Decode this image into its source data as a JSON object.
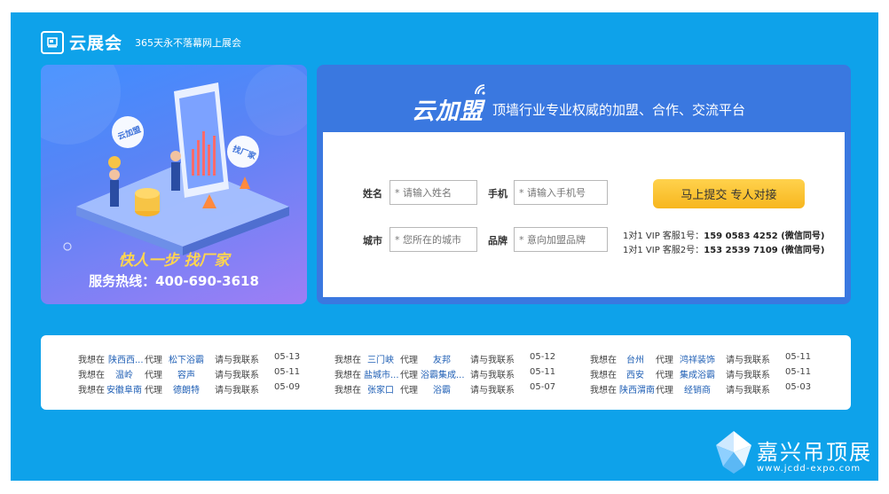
{
  "header": {
    "logo_name": "云展会",
    "slogan": "365天永不落幕网上展会"
  },
  "promo": {
    "title": "快人一步 找厂家",
    "hotline": "服务热线：400-690-3618",
    "bubble_left": "云加盟",
    "bubble_right": "找厂家"
  },
  "form": {
    "brand_name": "云加盟",
    "brand_slogan": "顶墙行业专业权威的加盟、合作、交流平台",
    "name_label": "姓名",
    "name_placeholder": "* 请输入姓名",
    "phone_label": "手机",
    "phone_placeholder": "* 请输入手机号",
    "city_label": "城市",
    "city_placeholder": "* 您所在的城市",
    "brand_label": "品牌",
    "brand_placeholder": "* 意向加盟品牌",
    "submit_label": "马上提交 专人对接",
    "service1_prefix": "1对1 VIP 客服1号：",
    "service1_number": "159 0583 4252 (微信同号)",
    "service2_prefix": "1对1 VIP 客服2号：",
    "service2_number": "153 2539 7109 (微信同号)"
  },
  "requests": [
    [
      {
        "want": "我想在",
        "city": "陕西西...",
        "act": "代理",
        "brand": "松下浴霸",
        "contact": "请与我联系",
        "date": "05-13"
      },
      {
        "want": "我想在",
        "city": "三门峡",
        "act": "代理",
        "brand": "友邦",
        "contact": "请与我联系",
        "date": "05-12"
      },
      {
        "want": "我想在",
        "city": "台州",
        "act": "代理",
        "brand": "鸿祥装饰",
        "contact": "请与我联系",
        "date": "05-11"
      }
    ],
    [
      {
        "want": "我想在",
        "city": "温岭",
        "act": "代理",
        "brand": "容声",
        "contact": "请与我联系",
        "date": "05-11"
      },
      {
        "want": "我想在",
        "city": "盐城市...",
        "act": "代理",
        "brand": "浴霸集成...",
        "contact": "请与我联系",
        "date": "05-11"
      },
      {
        "want": "我想在",
        "city": "西安",
        "act": "代理",
        "brand": "集成浴霸",
        "contact": "请与我联系",
        "date": "05-11"
      }
    ],
    [
      {
        "want": "我想在",
        "city": "安徽阜南",
        "act": "代理",
        "brand": "德朗特",
        "contact": "请与我联系",
        "date": "05-09"
      },
      {
        "want": "我想在",
        "city": "张家口",
        "act": "代理",
        "brand": "浴霸",
        "contact": "请与我联系",
        "date": "05-07"
      },
      {
        "want": "我想在",
        "city": "陕西渭南",
        "act": "代理",
        "brand": "经销商",
        "contact": "请与我联系",
        "date": "05-03"
      }
    ]
  ],
  "footer": {
    "site_name": "嘉兴吊顶展",
    "site_url": "www.jcdd-expo.com"
  },
  "colors": {
    "background": "#0ea2ea",
    "panel_header": "#3a78e0",
    "button": "#f7b61e",
    "link": "#1f5fb5"
  }
}
